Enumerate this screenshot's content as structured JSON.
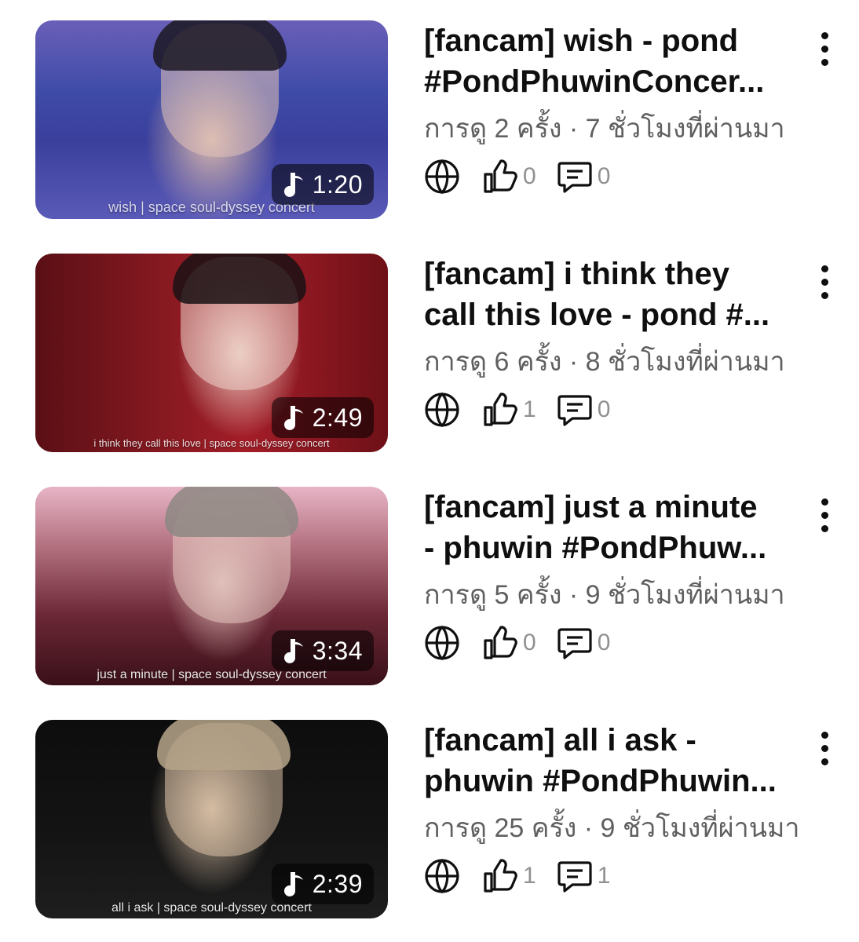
{
  "videos": [
    {
      "title_line1": "[fancam] wish - pond",
      "title_line2": "#PondPhuwinConcer...",
      "thumbnail_caption": "wish | space soul-dyssey concert",
      "duration": "1:20",
      "meta": "การดู 2 ครั้ง · 7 ชั่วโมงที่ผ่านมา",
      "likes": "0",
      "comments": "0"
    },
    {
      "title_line1": "[fancam] i think they",
      "title_line2": "call this love - pond #...",
      "thumbnail_caption": "i think they call this love | space soul-dyssey concert",
      "duration": "2:49",
      "meta": "การดู 6 ครั้ง · 8 ชั่วโมงที่ผ่านมา",
      "likes": "1",
      "comments": "0"
    },
    {
      "title_line1": "[fancam] just a minute",
      "title_line2": "- phuwin #PondPhuw...",
      "thumbnail_caption": "just a minute | space soul-dyssey concert",
      "duration": "3:34",
      "meta": "การดู 5 ครั้ง · 9 ชั่วโมงที่ผ่านมา",
      "likes": "0",
      "comments": "0"
    },
    {
      "title_line1": "[fancam] all i ask -",
      "title_line2": "phuwin #PondPhuwin...",
      "thumbnail_caption": "all i ask | space soul-dyssey concert",
      "duration": "2:39",
      "meta": "การดู 25 ครั้ง · 9 ชั่วโมงที่ผ่านมา",
      "likes": "1",
      "comments": "1"
    }
  ],
  "icons": {
    "duration": "music-note-icon",
    "visibility": "globe-icon",
    "likes": "thumbs-up-icon",
    "comments": "comment-icon",
    "menu": "more-vertical-icon"
  },
  "colors": {
    "title": "#0f0f0f",
    "meta": "#606060",
    "count": "#909090",
    "duration_badge": "rgba(0,0,0,0.55)"
  }
}
